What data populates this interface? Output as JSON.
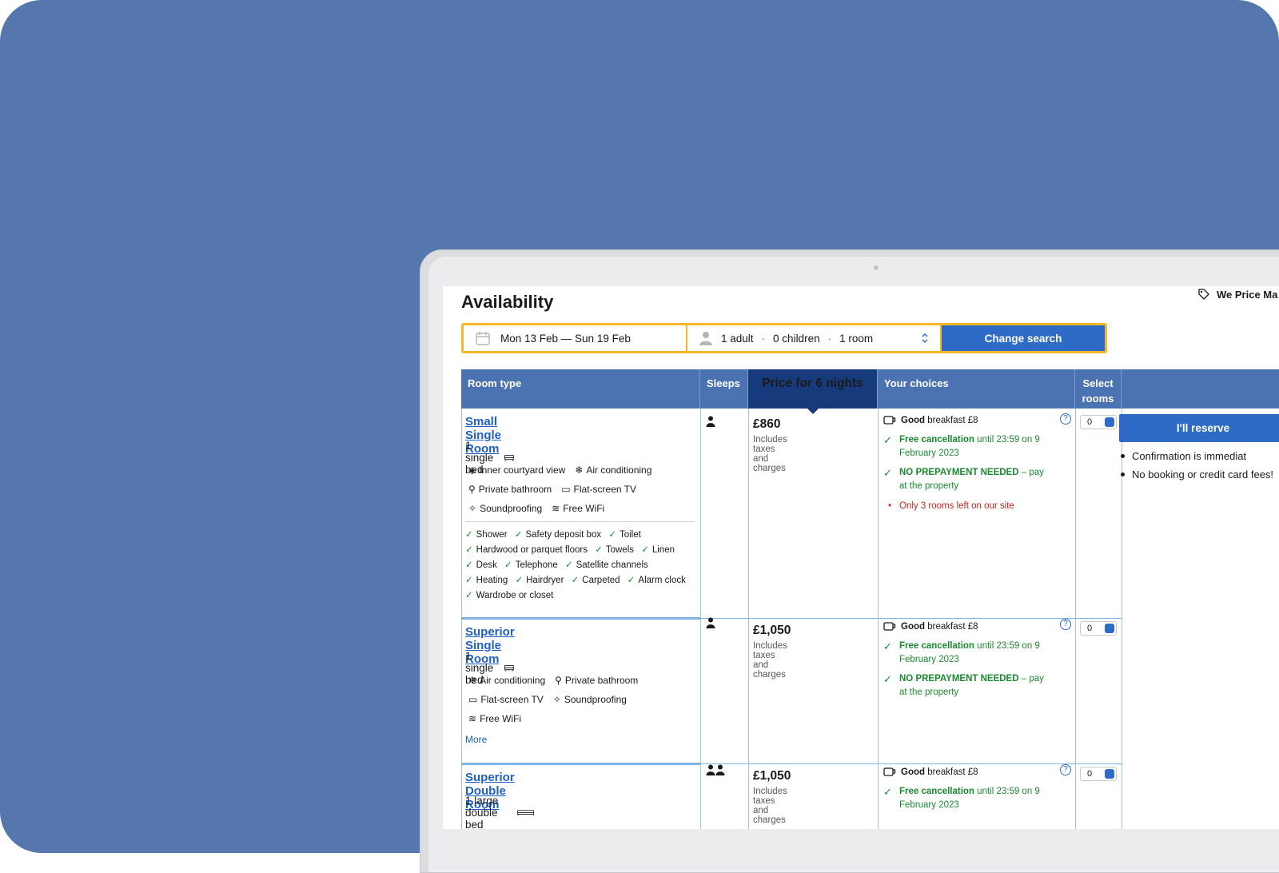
{
  "page": {
    "title": "Availability",
    "price_match": "We Price Ma"
  },
  "search": {
    "dates": "Mon 13 Feb — Sun 19 Feb",
    "adults": "1 adult",
    "children": "0 children",
    "rooms": "1 room",
    "button": "Change search"
  },
  "table": {
    "headers": {
      "room_type": "Room type",
      "sleeps": "Sleeps",
      "price": "Price for 6 nights",
      "choices": "Your choices",
      "select_line1": "Select",
      "select_line2": "rooms"
    }
  },
  "rooms": [
    {
      "name": "Small Single Room",
      "bed": "1 single bed",
      "facilities": [
        "Inner courtyard view",
        "Air conditioning",
        "Private bathroom",
        "Flat-screen TV",
        "Soundproofing",
        "Free WiFi"
      ],
      "amenities": [
        "Shower",
        "Safety deposit box",
        "Toilet",
        "Hardwood or parquet floors",
        "Towels",
        "Linen",
        "Desk",
        "Telephone",
        "Satellite channels",
        "Heating",
        "Hairdryer",
        "Carpeted",
        "Alarm clock",
        "Wardrobe or closet"
      ],
      "price": "£860",
      "taxes": "Includes taxes and charges",
      "breakfast_bold": "Good",
      "breakfast_rest": "breakfast £8",
      "cancel_bold": "Free cancellation",
      "cancel_rest": "until 23:59 on 9 February 2023",
      "prepay_bold": "NO PREPAYMENT NEEDED",
      "prepay_rest": "– pay at the property",
      "scarcity": "Only 3 rooms left on our site",
      "select_value": "0"
    },
    {
      "name": "Superior Single Room",
      "bed": "1 single bed",
      "facilities": [
        "Air conditioning",
        "Private bathroom",
        "Flat-screen TV",
        "Soundproofing",
        "Free WiFi"
      ],
      "more": "More",
      "price": "£1,050",
      "taxes": "Includes taxes and charges",
      "breakfast_bold": "Good",
      "breakfast_rest": "breakfast £8",
      "cancel_bold": "Free cancellation",
      "cancel_rest": "until 23:59 on 9 February 2023",
      "prepay_bold": "NO PREPAYMENT NEEDED",
      "prepay_rest": "– pay at the property",
      "select_value": "0"
    },
    {
      "name": "Superior Double Room",
      "bed": "1 large double bed",
      "price": "£1,050",
      "taxes": "Includes taxes and charges",
      "breakfast_bold": "Good",
      "breakfast_rest": "breakfast £8",
      "cancel_bold": "Free cancellation",
      "cancel_rest": "until 23:59 on 9 February 2023",
      "select_value": "0"
    }
  ],
  "reserve": {
    "button": "I'll reserve",
    "bullets": [
      "Confirmation is immediat",
      "No booking or credit card fees!"
    ]
  },
  "colors": {
    "background": "#5677ad",
    "primary_blue": "#2e6bc6",
    "header_blue": "#4b73b1",
    "price_header": "#173a7d",
    "search_border": "#f2b826",
    "green": "#1b8a2f",
    "red": "#c0271f"
  }
}
